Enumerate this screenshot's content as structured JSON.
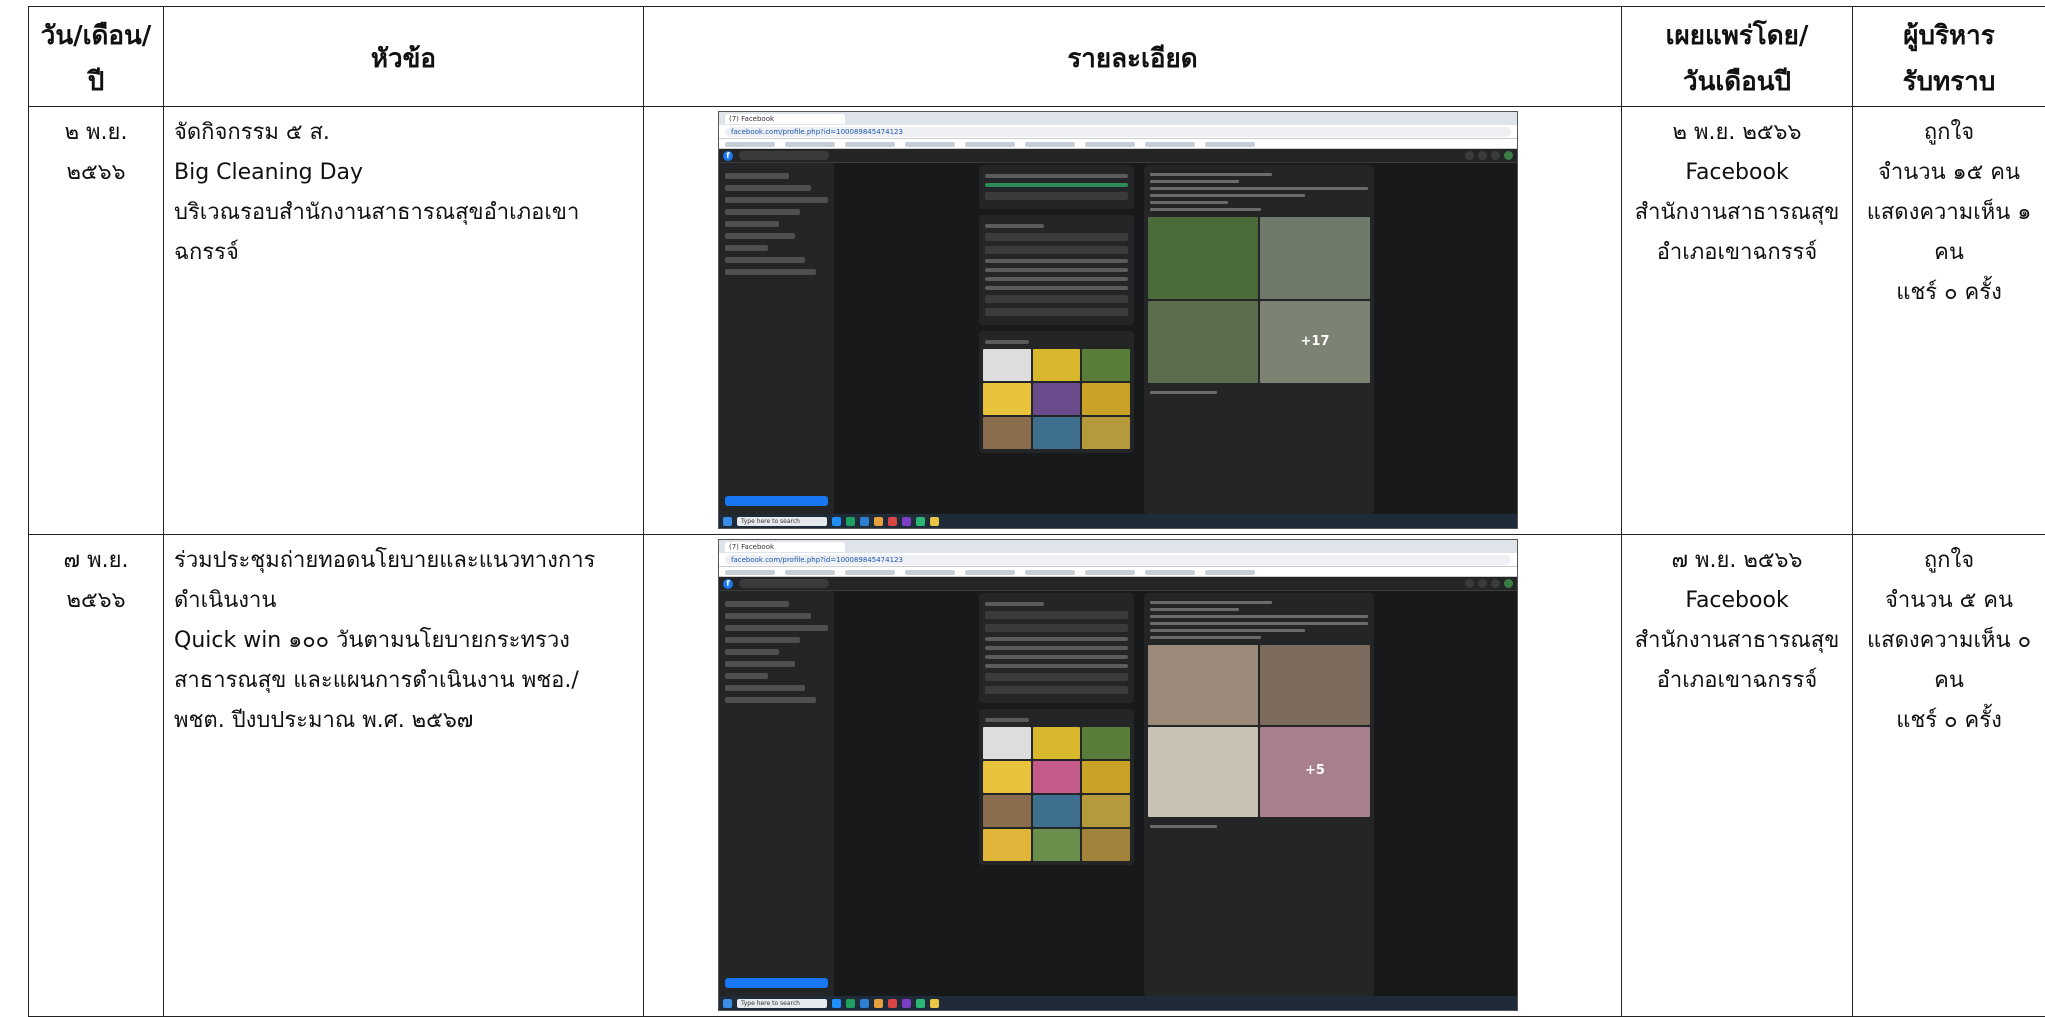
{
  "header": {
    "col_date": [
      "วัน/เดือน/",
      "ปี"
    ],
    "col_topic": "หัวข้อ",
    "col_detail": "รายละเอียด",
    "col_pub": [
      "เผยแพร่โดย/",
      "วันเดือนปี"
    ],
    "col_ack": [
      "ผู้บริหาร",
      "รับทราบ"
    ]
  },
  "rows": [
    {
      "date": [
        "๒ พ.ย.",
        "๒๕๖๖"
      ],
      "topic": [
        "จัดกิจกรรม ๕ ส.",
        "Big Cleaning Day",
        "บริเวณรอบสำนักงานสาธารณสุขอำเภอเขา",
        "ฉกรรจ์"
      ],
      "pub": [
        "๒ พ.ย. ๒๕๖๖",
        "Facebook",
        "สำนักงานสาธารณสุข",
        "อำเภอเขาฉกรรจ์"
      ],
      "ack": [
        "ถูกใจ",
        "จำนวน ๑๕ คน",
        "แสดงความเห็น ๑",
        "คน",
        "แชร์ ๐ ครั้ง"
      ],
      "screenshot": {
        "tab": "(7) Facebook",
        "url": "facebook.com/profile.php?id=100089845474123",
        "plus": "+17",
        "taskbar_search": "Type here to search"
      }
    },
    {
      "date": [
        "๗ พ.ย.",
        "๒๕๖๖"
      ],
      "topic": [
        "ร่วมประชุมถ่ายทอดนโยบายและแนวทางการ",
        "ดำเนินงาน",
        "Quick win ๑๐๐ วันตามนโยบายกระทรวง",
        "สาธารณสุข และแผนการดำเนินงาน พชอ./",
        "พชต. ปีงบประมาณ พ.ศ. ๒๕๖๗"
      ],
      "pub": [
        "๗ พ.ย. ๒๕๖๖",
        "Facebook",
        "สำนักงานสาธารณสุข",
        "อำเภอเขาฉกรรจ์"
      ],
      "ack": [
        "ถูกใจ",
        "จำนวน ๕ คน",
        "แสดงความเห็น ๐",
        "คน",
        "แชร์ ๐ ครั้ง"
      ],
      "screenshot": {
        "tab": "(7) Facebook",
        "url": "facebook.com/profile.php?id=100089845474123",
        "plus": "+5",
        "taskbar_search": "Type here to search"
      }
    }
  ],
  "colors": {
    "border": "#222222",
    "fb_dark": "#18191a",
    "fb_blue": "#1877f2"
  }
}
